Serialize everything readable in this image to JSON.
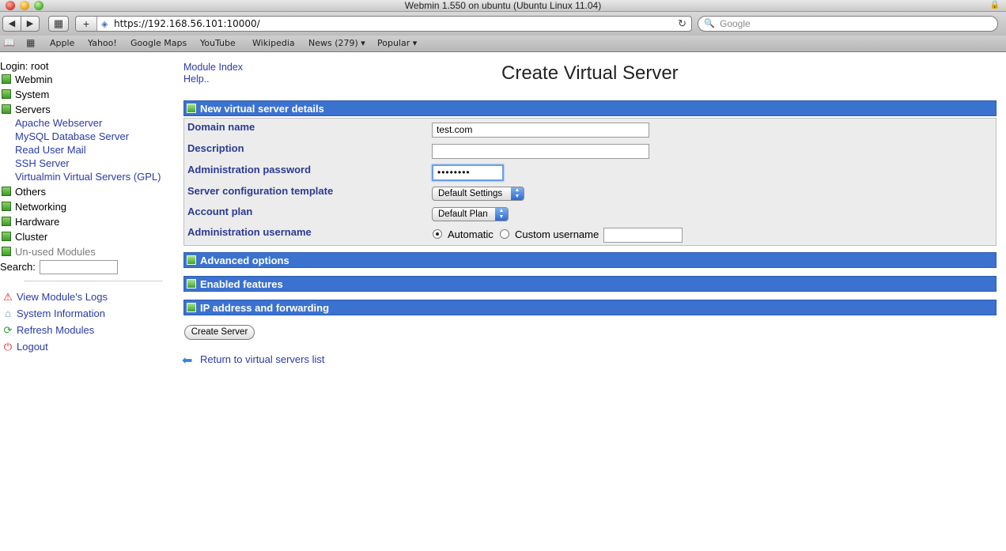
{
  "browser": {
    "window_title": "Webmin 1.550 on ubuntu (Ubuntu Linux 11.04)",
    "url": "https://192.168.56.101:10000/",
    "search_placeholder": "Google",
    "bookmarks": [
      "Apple",
      "Yahoo!",
      "Google Maps",
      "YouTube",
      "Wikipedia",
      "News (279) ▾",
      "Popular ▾"
    ]
  },
  "sidebar": {
    "login": "Login: root",
    "categories": [
      "Webmin",
      "System",
      "Servers",
      "Others",
      "Networking",
      "Hardware",
      "Cluster",
      "Un-used Modules"
    ],
    "server_modules": [
      "Apache Webserver",
      "MySQL Database Server",
      "Read User Mail",
      "SSH Server",
      "Virtualmin Virtual Servers (GPL)"
    ],
    "search_label": "Search:",
    "links": [
      {
        "label": "View Module's Logs",
        "icon": "warning-icon"
      },
      {
        "label": "System Information",
        "icon": "house-icon"
      },
      {
        "label": "Refresh Modules",
        "icon": "refresh-icon"
      },
      {
        "label": "Logout",
        "icon": "power-icon"
      }
    ]
  },
  "main": {
    "module_index": "Module Index",
    "help": "Help..",
    "title": "Create Virtual Server",
    "sections": [
      "New virtual server details",
      "Advanced options",
      "Enabled features",
      "IP address and forwarding"
    ],
    "form": {
      "domain_label": "Domain name",
      "domain_value": "test.com",
      "description_label": "Description",
      "description_value": "",
      "password_label": "Administration password",
      "password_value": "••••••••",
      "template_label": "Server configuration template",
      "template_value": "Default Settings",
      "plan_label": "Account plan",
      "plan_value": "Default Plan",
      "username_label": "Administration username",
      "username_option_auto": "Automatic",
      "username_option_custom": "Custom username",
      "username_custom_value": ""
    },
    "create_button": "Create Server",
    "return_link": "Return to virtual servers list"
  },
  "colors": {
    "section_header": "#3b72d0",
    "link": "#2b3aa8",
    "label": "#2d3a92"
  }
}
